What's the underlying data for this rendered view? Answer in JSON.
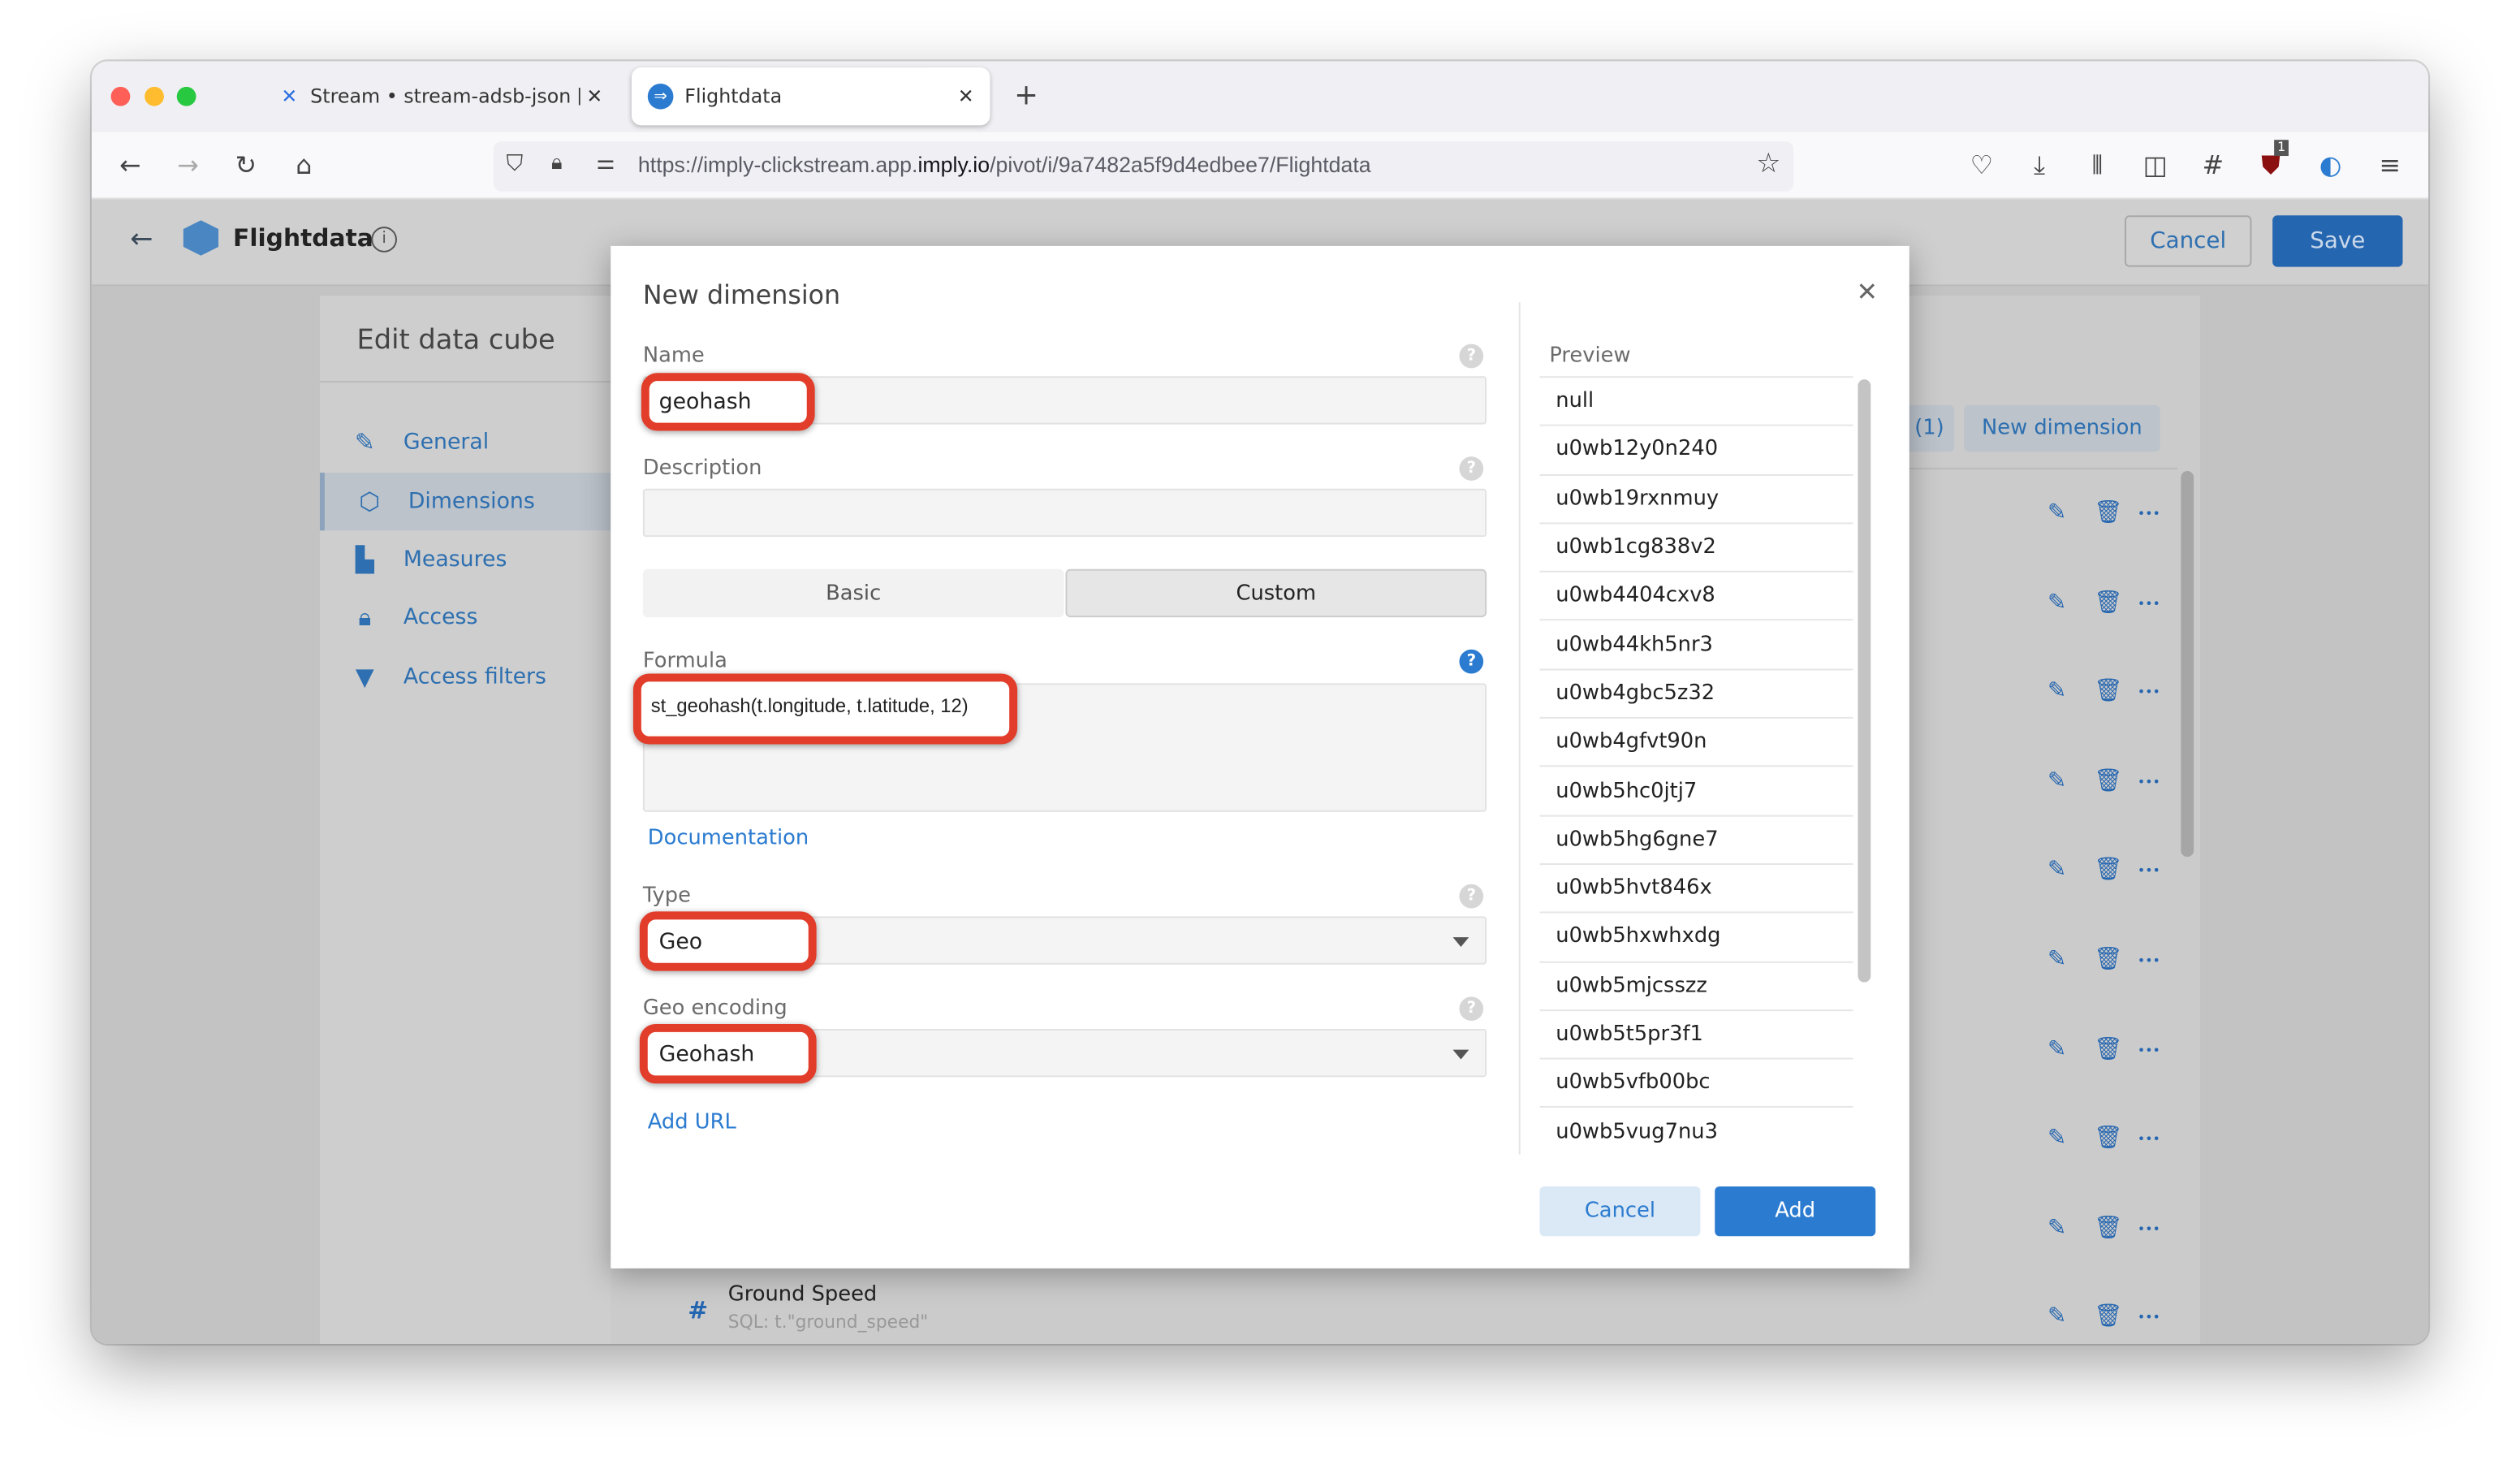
{
  "browser": {
    "tabs": [
      {
        "label": "Stream • stream-adsb-json [De",
        "active": false
      },
      {
        "label": "Flightdata",
        "active": true
      }
    ],
    "url_prefix": "https://imply-clickstream.app.",
    "url_domain": "imply.io",
    "url_path": "/pivot/i/9a7482a5f9d4edbee7/Flightdata",
    "extension_badge": "1"
  },
  "app": {
    "title": "Flightdata",
    "cancel_label": "Cancel",
    "save_label": "Save",
    "sidebar_title": "Edit data cube",
    "nav": [
      {
        "label": "General",
        "icon": "edit-icon"
      },
      {
        "label": "Dimensions",
        "icon": "cube-icon",
        "active": true
      },
      {
        "label": "Measures",
        "icon": "measures-icon"
      },
      {
        "label": "Access",
        "icon": "lock-icon"
      },
      {
        "label": "Access filters",
        "icon": "filter-icon"
      }
    ],
    "count_button": "(1)",
    "new_dimension_label": "New dimension",
    "visible_dimension": {
      "name": "Ground Speed",
      "sql": "SQL: t.\"ground_speed\""
    }
  },
  "dialog": {
    "title": "New dimension",
    "name_label": "Name",
    "name_value": "geohash",
    "description_label": "Description",
    "description_value": "",
    "mode_tabs": [
      "Basic",
      "Custom"
    ],
    "active_mode": "Custom",
    "formula_label": "Formula",
    "formula_value": "st_geohash(t.longitude, t.latitude, 12)",
    "documentation_link": "Documentation",
    "type_label": "Type",
    "type_value": "Geo",
    "geo_encoding_label": "Geo encoding",
    "geo_encoding_value": "Geohash",
    "add_url_link": "Add URL",
    "preview_label": "Preview",
    "preview_values": [
      "null",
      "u0wb12y0n240",
      "u0wb19rxnmuy",
      "u0wb1cg838v2",
      "u0wb4404cxv8",
      "u0wb44kh5nr3",
      "u0wb4gbc5z32",
      "u0wb4gfvt90n",
      "u0wb5hc0jtj7",
      "u0wb5hg6gne7",
      "u0wb5hvt846x",
      "u0wb5hxwhxdg",
      "u0wb5mjcsszz",
      "u0wb5t5pr3f1",
      "u0wb5vfb00bc",
      "u0wb5vug7nu3"
    ],
    "cancel_label": "Cancel",
    "add_label": "Add"
  },
  "colors": {
    "accent": "#2b7bd0",
    "save": "#2566b0",
    "highlight": "#e23d2a"
  }
}
